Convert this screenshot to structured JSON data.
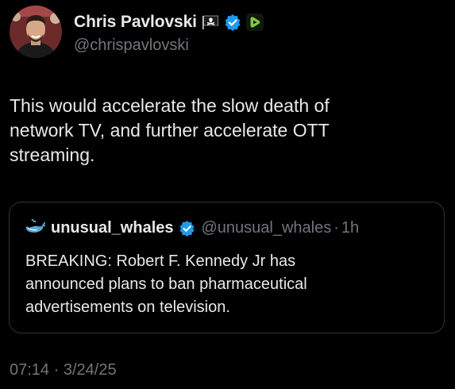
{
  "tweet": {
    "author": {
      "display_name": "Chris Pavlovski",
      "handle": "@chrispavlovski",
      "badges": [
        "pirate-flag-icon",
        "verified-badge-icon",
        "rumble-logo-icon"
      ]
    },
    "text": "This would accelerate the slow death of\nnetwork TV, and further accelerate OTT\nstreaming.",
    "quote": {
      "author": {
        "display_name": "unusual_whales",
        "handle": "@unusual_whales",
        "avatar_icon": "whale-icon",
        "verified": true
      },
      "separator": "·",
      "time_ago": "1h",
      "text": "BREAKING: Robert F. Kennedy Jr has\nannounced plans to ban pharmaceutical\nadvertisements on television."
    },
    "timestamp": {
      "time": "07:14",
      "separator": "·",
      "date": "3/24/25"
    }
  },
  "colors": {
    "background": "#000000",
    "primary_text": "#e7e9ea",
    "secondary_text": "#71767b",
    "verified_blue": "#1d9bf0",
    "rumble_green": "#85c742",
    "border": "#2f3336"
  }
}
